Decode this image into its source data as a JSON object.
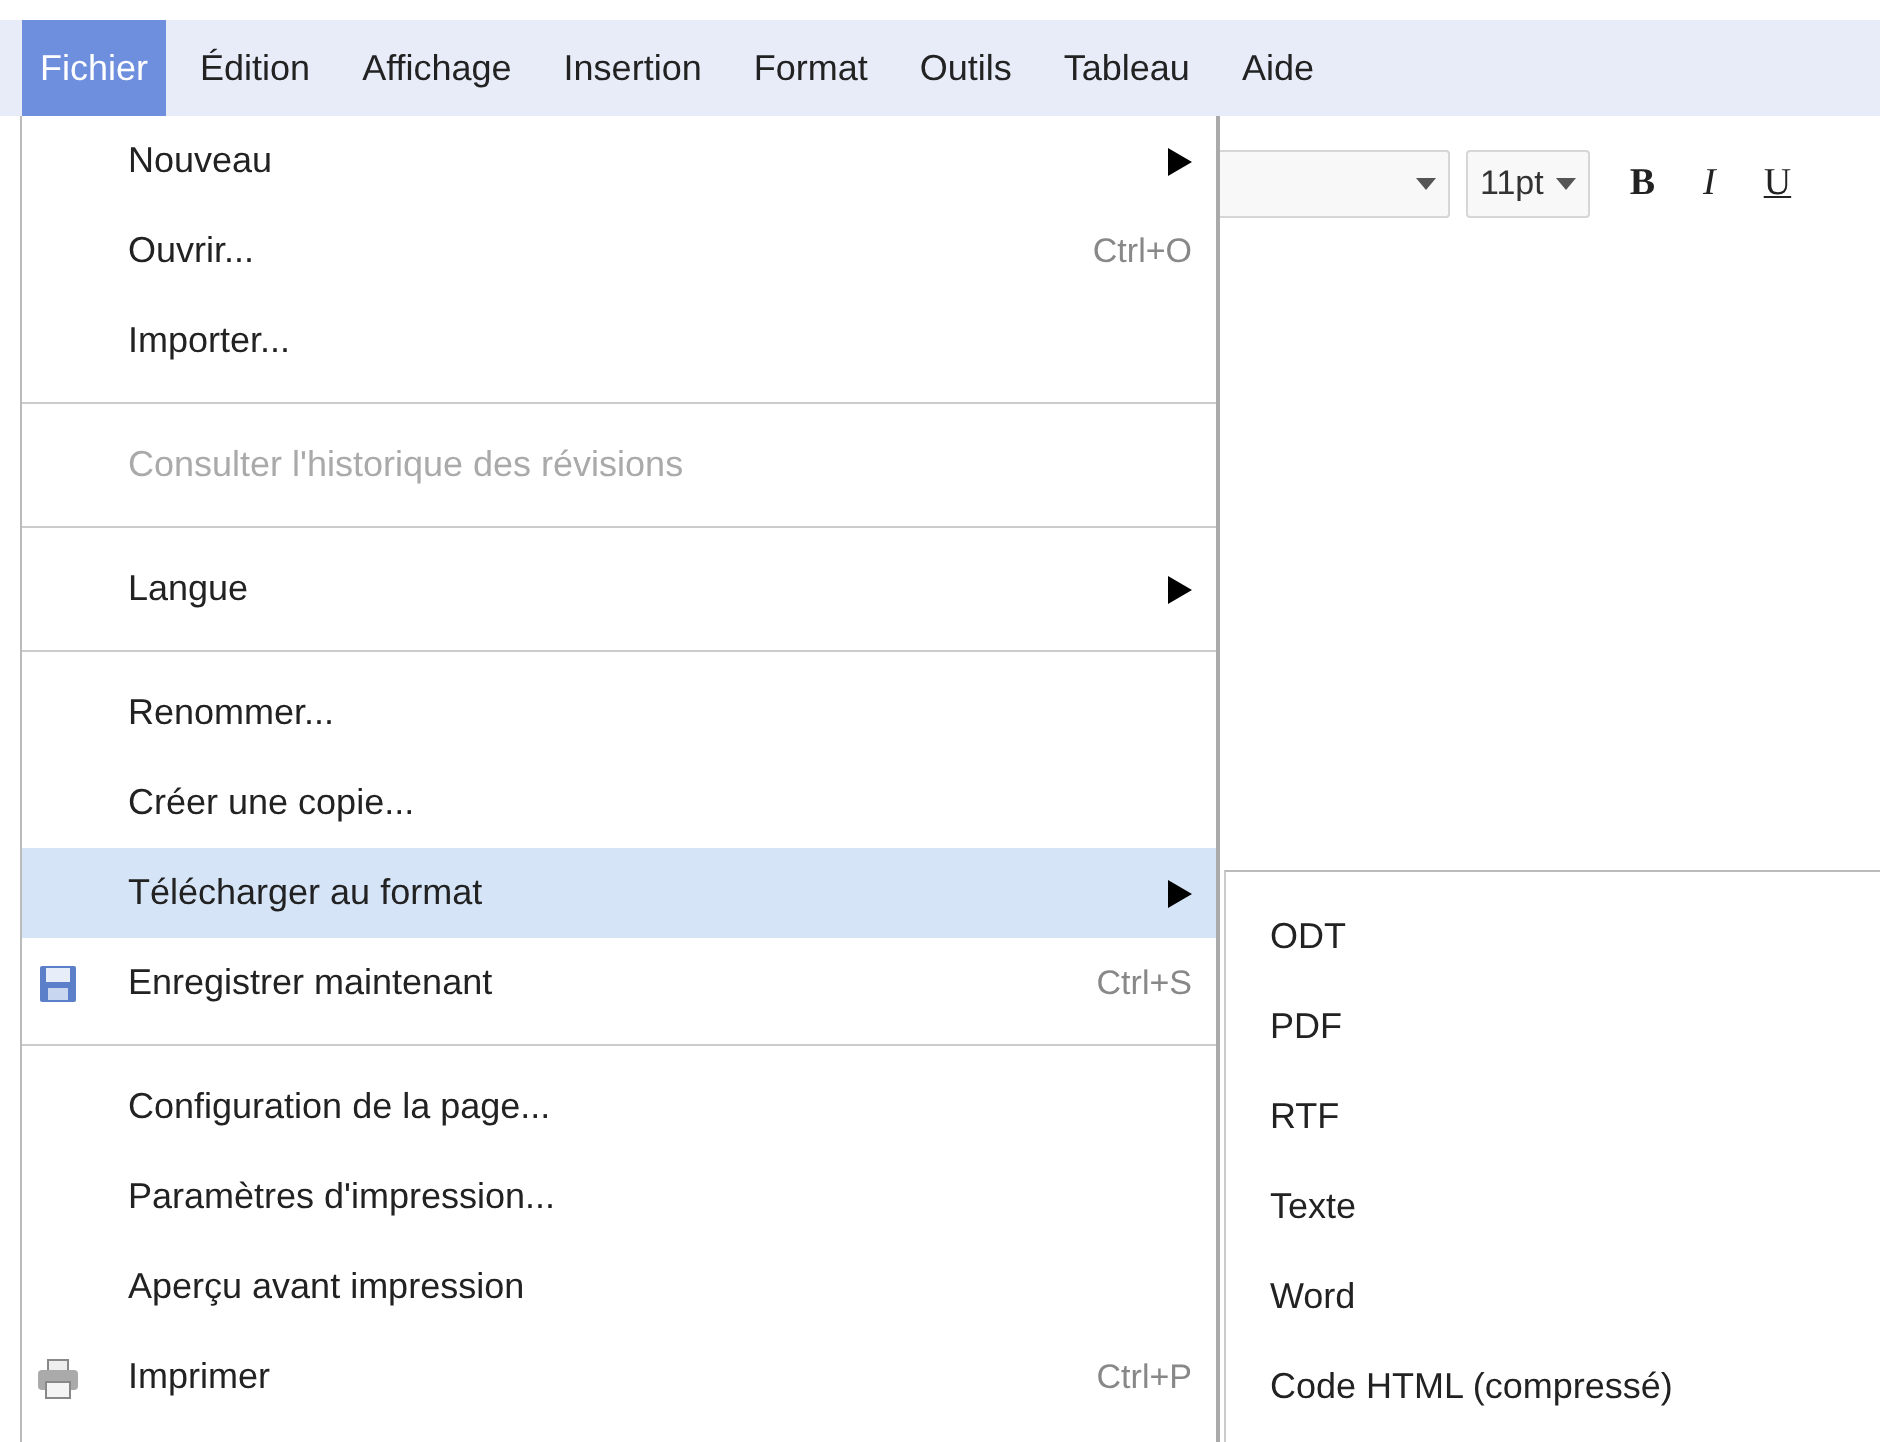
{
  "menubar": [
    {
      "label": "Fichier",
      "selected": true
    },
    {
      "label": "Édition",
      "selected": false
    },
    {
      "label": "Affichage",
      "selected": false
    },
    {
      "label": "Insertion",
      "selected": false
    },
    {
      "label": "Format",
      "selected": false
    },
    {
      "label": "Outils",
      "selected": false
    },
    {
      "label": "Tableau",
      "selected": false
    },
    {
      "label": "Aide",
      "selected": false
    }
  ],
  "toolbar": {
    "font_size": "11pt",
    "buttons": [
      {
        "label": "B",
        "kind": "bold"
      },
      {
        "label": "I",
        "kind": "italic"
      },
      {
        "label": "U",
        "kind": "underline"
      }
    ]
  },
  "menu": {
    "items": [
      {
        "kind": "item",
        "label": "Nouveau",
        "submenu": true,
        "disabled": false,
        "selected": false
      },
      {
        "kind": "item",
        "label": "Ouvrir...",
        "shortcut": "Ctrl+O",
        "disabled": false,
        "selected": false
      },
      {
        "kind": "item",
        "label": "Importer...",
        "disabled": false,
        "selected": false
      },
      {
        "kind": "separator"
      },
      {
        "kind": "item",
        "label": "Consulter l'historique des révisions",
        "disabled": true,
        "selected": false
      },
      {
        "kind": "separator"
      },
      {
        "kind": "item",
        "label": "Langue",
        "submenu": true,
        "disabled": false,
        "selected": false
      },
      {
        "kind": "separator"
      },
      {
        "kind": "item",
        "label": "Renommer...",
        "disabled": false,
        "selected": false
      },
      {
        "kind": "item",
        "label": "Créer une copie...",
        "disabled": false,
        "selected": false
      },
      {
        "kind": "item",
        "label": "Télécharger au format",
        "submenu": true,
        "disabled": false,
        "selected": true
      },
      {
        "kind": "save-item",
        "label": "Enregistrer maintenant",
        "shortcut": "Ctrl+S",
        "disabled": false,
        "selected": false
      },
      {
        "kind": "separator"
      },
      {
        "kind": "item",
        "label": "Configuration de la page...",
        "disabled": false,
        "selected": false
      },
      {
        "kind": "item",
        "label": "Paramètres d'impression...",
        "disabled": false,
        "selected": false
      },
      {
        "kind": "item",
        "label": "Aperçu avant impression",
        "disabled": false,
        "selected": false
      },
      {
        "kind": "print-item",
        "label": "Imprimer",
        "shortcut": "Ctrl+P",
        "disabled": false,
        "selected": false
      }
    ]
  },
  "submenu": {
    "items": [
      {
        "label": "ODT"
      },
      {
        "label": "PDF"
      },
      {
        "label": "RTF"
      },
      {
        "label": "Texte"
      },
      {
        "label": "Word"
      },
      {
        "label": "Code HTML (compressé)"
      }
    ]
  }
}
